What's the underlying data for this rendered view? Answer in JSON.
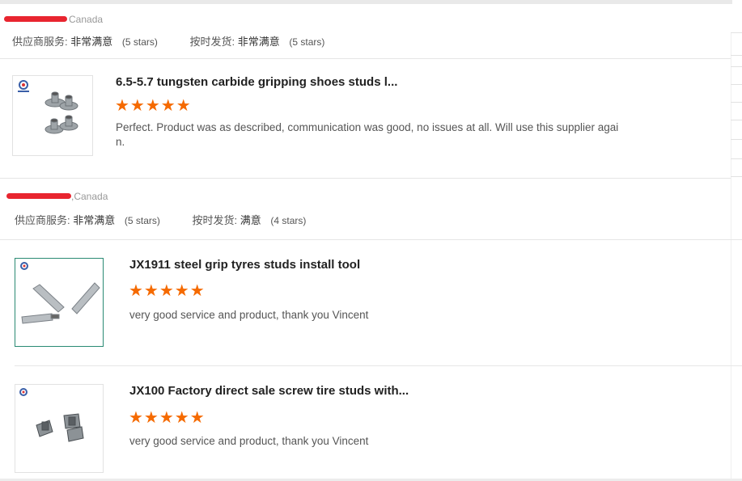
{
  "reviews": [
    {
      "buyer_country": "Canada",
      "ratings": [
        {
          "label": "供应商服务:",
          "value": "非常满意",
          "stars": "(5 stars)"
        },
        {
          "label": "按时发货:",
          "value": "非常满意",
          "stars": "(5 stars)"
        }
      ],
      "products": [
        {
          "title": "6.5-5.7 tungsten carbide gripping shoes studs l...",
          "rating": 5,
          "comment_line1": "Perfect.  Product was as described, communication was good, no issues at all.  Will use this supplier agai",
          "comment_line2": "n."
        }
      ]
    },
    {
      "buyer_country": ",Canada",
      "ratings": [
        {
          "label": "供应商服务:",
          "value": "非常满意",
          "stars": "(5 stars)"
        },
        {
          "label": "按时发货:",
          "value": "满意",
          "stars": "(4 stars)"
        }
      ],
      "products": [
        {
          "title": "JX1911 steel grip tyres studs install tool",
          "rating": 5,
          "comment_line1": "very good service and product, thank you Vincent"
        },
        {
          "title": "JX100 Factory direct sale screw tire studs with...",
          "rating": 5,
          "comment_line1": "very good service and product, thank you Vincent"
        }
      ]
    }
  ],
  "star_glyph": "★★★★★",
  "star_color": "#f56a00",
  "icons": [
    "brand-logo-icon",
    "product-photo-studs",
    "product-photo-tool",
    "product-photo-screw-studs"
  ]
}
